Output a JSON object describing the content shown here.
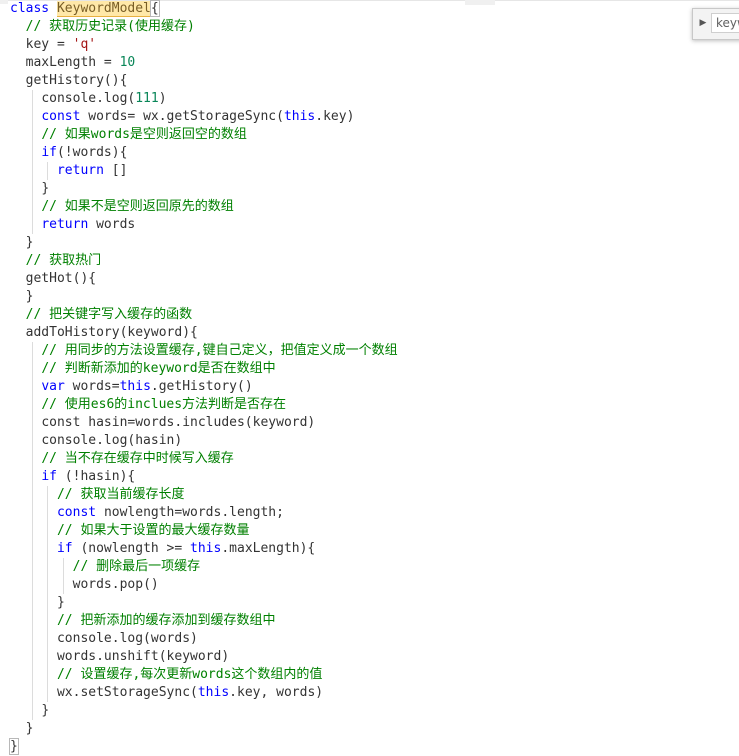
{
  "editor": {
    "lines": [
      {
        "indent": 0,
        "tokens": [
          {
            "t": "class ",
            "c": "kw"
          },
          {
            "t": "KeywordModel",
            "c": "hl"
          },
          {
            "t": "{",
            "c": "brk"
          }
        ]
      },
      {
        "indent": 1,
        "tokens": [
          {
            "t": "// 获取历史记录(使用缓存)",
            "c": "cm"
          }
        ]
      },
      {
        "indent": 1,
        "tokens": [
          {
            "t": "key = "
          },
          {
            "t": "'q'",
            "c": "str"
          }
        ]
      },
      {
        "indent": 1,
        "tokens": [
          {
            "t": "maxLength = "
          },
          {
            "t": "10",
            "c": "num"
          }
        ]
      },
      {
        "indent": 1,
        "tokens": [
          {
            "t": "getHistory(){"
          }
        ]
      },
      {
        "indent": 2,
        "tokens": [
          {
            "t": "console.log("
          },
          {
            "t": "111",
            "c": "num"
          },
          {
            "t": ")"
          }
        ]
      },
      {
        "indent": 2,
        "tokens": [
          {
            "t": "const ",
            "c": "kw"
          },
          {
            "t": "words= wx.getStorageSync("
          },
          {
            "t": "this",
            "c": "kw"
          },
          {
            "t": ".key)"
          }
        ]
      },
      {
        "indent": 2,
        "tokens": [
          {
            "t": "// 如果words是空则返回空的数组",
            "c": "cm"
          }
        ]
      },
      {
        "indent": 2,
        "tokens": [
          {
            "t": "if",
            "c": "kw"
          },
          {
            "t": "(!words){"
          }
        ]
      },
      {
        "indent": 3,
        "tokens": [
          {
            "t": "return ",
            "c": "kw"
          },
          {
            "t": "[]"
          }
        ]
      },
      {
        "indent": 2,
        "tokens": [
          {
            "t": "}"
          }
        ]
      },
      {
        "indent": 2,
        "tokens": [
          {
            "t": "// 如果不是空则返回原先的数组",
            "c": "cm"
          }
        ]
      },
      {
        "indent": 2,
        "tokens": [
          {
            "t": "return ",
            "c": "kw"
          },
          {
            "t": "words"
          }
        ]
      },
      {
        "indent": 1,
        "tokens": [
          {
            "t": "}"
          }
        ]
      },
      {
        "indent": 1,
        "tokens": [
          {
            "t": "// 获取热门",
            "c": "cm"
          }
        ]
      },
      {
        "indent": 1,
        "tokens": [
          {
            "t": "getHot(){"
          }
        ]
      },
      {
        "indent": 1,
        "tokens": [
          {
            "t": "}"
          }
        ]
      },
      {
        "indent": 1,
        "tokens": [
          {
            "t": "// 把关键字写入缓存的函数",
            "c": "cm"
          }
        ]
      },
      {
        "indent": 1,
        "tokens": [
          {
            "t": "addToHistory(keyword){"
          }
        ]
      },
      {
        "indent": 2,
        "tokens": [
          {
            "t": "// 用同步的方法设置缓存,键自己定义，把值定义成一个数组",
            "c": "cm"
          }
        ]
      },
      {
        "indent": 2,
        "tokens": [
          {
            "t": "// 判断新添加的keyword是否在数组中",
            "c": "cm"
          }
        ]
      },
      {
        "indent": 2,
        "tokens": [
          {
            "t": "var ",
            "c": "kw"
          },
          {
            "t": "words="
          },
          {
            "t": "this",
            "c": "kw"
          },
          {
            "t": ".getHistory()"
          }
        ]
      },
      {
        "indent": 2,
        "tokens": [
          {
            "t": "// 使用es6的inclues方法判断是否存在",
            "c": "cm"
          }
        ]
      },
      {
        "indent": 2,
        "tokens": [
          {
            "t": "const hasin=words.includes(keyword)"
          }
        ]
      },
      {
        "indent": 2,
        "tokens": [
          {
            "t": "console.log(hasin)"
          }
        ]
      },
      {
        "indent": 2,
        "tokens": [
          {
            "t": "// 当不存在缓存中时候写入缓存",
            "c": "cm"
          }
        ]
      },
      {
        "indent": 2,
        "tokens": [
          {
            "t": "if ",
            "c": "kw"
          },
          {
            "t": "(!hasin){"
          }
        ]
      },
      {
        "indent": 3,
        "tokens": [
          {
            "t": "// 获取当前缓存长度",
            "c": "cm"
          }
        ]
      },
      {
        "indent": 3,
        "tokens": [
          {
            "t": "const ",
            "c": "kw"
          },
          {
            "t": "nowlength=words.length;"
          }
        ]
      },
      {
        "indent": 3,
        "tokens": [
          {
            "t": "// 如果大于设置的最大缓存数量",
            "c": "cm"
          }
        ]
      },
      {
        "indent": 3,
        "tokens": [
          {
            "t": "if ",
            "c": "kw"
          },
          {
            "t": "(nowlength >= "
          },
          {
            "t": "this",
            "c": "kw"
          },
          {
            "t": ".maxLength){"
          }
        ]
      },
      {
        "indent": 4,
        "tokens": [
          {
            "t": "// 删除最后一项缓存",
            "c": "cm"
          }
        ]
      },
      {
        "indent": 4,
        "tokens": [
          {
            "t": "words.pop()"
          }
        ]
      },
      {
        "indent": 3,
        "tokens": [
          {
            "t": "}"
          }
        ]
      },
      {
        "indent": 3,
        "tokens": [
          {
            "t": "// 把新添加的缓存添加到缓存数组中",
            "c": "cm"
          }
        ]
      },
      {
        "indent": 3,
        "tokens": [
          {
            "t": "console.log(words)"
          }
        ]
      },
      {
        "indent": 3,
        "tokens": [
          {
            "t": "words.unshift(keyword)"
          }
        ]
      },
      {
        "indent": 3,
        "tokens": [
          {
            "t": "// 设置缓存,每次更新words这个数组内的值",
            "c": "cm"
          }
        ]
      },
      {
        "indent": 3,
        "tokens": [
          {
            "t": "wx.setStorageSync("
          },
          {
            "t": "this",
            "c": "kw"
          },
          {
            "t": ".key, words)"
          }
        ]
      },
      {
        "indent": 2,
        "tokens": [
          {
            "t": "}"
          }
        ]
      },
      {
        "indent": 1,
        "tokens": [
          {
            "t": "}"
          }
        ]
      },
      {
        "indent": 0,
        "tokens": [
          {
            "t": "}",
            "c": "brk"
          }
        ]
      }
    ]
  },
  "find_widget": {
    "value": "keyw",
    "toggle_glyph": "▶"
  },
  "colors": {
    "keyword": "#0000ff",
    "comment": "#008000",
    "number": "#098658",
    "string": "#a31515",
    "match_highlight": "#ffe8a8"
  }
}
